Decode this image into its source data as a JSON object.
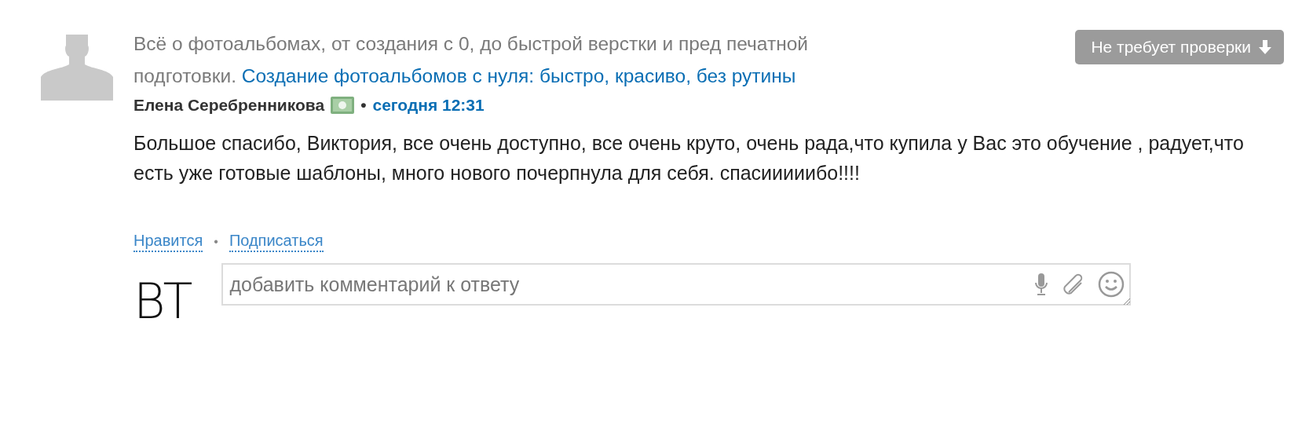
{
  "question": {
    "text": "Всё о фотоальбомах, от создания с 0, до быстрой верстки и пред печатной подготовки.",
    "link": "Создание фотоальбомов с нуля: быстро, красиво, без рутины"
  },
  "status_button": {
    "label": "Не требует проверки"
  },
  "author": {
    "name": "Елена Серебренникова",
    "separator": "•",
    "time": "сегодня 12:31"
  },
  "answer": "Большое спасибо, Виктория, все очень доступно, все очень круто, очень рада,что купила у Вас это обучение , радует,что есть уже готовые шаблоны, много нового почерпнула для себя. спасииииибо!!!!",
  "actions": [
    {
      "label": "Нравится"
    },
    {
      "label": "Подписаться"
    }
  ],
  "action_separator": "•",
  "reply": {
    "logo": "BT",
    "placeholder": "добавить комментарий к ответу"
  }
}
